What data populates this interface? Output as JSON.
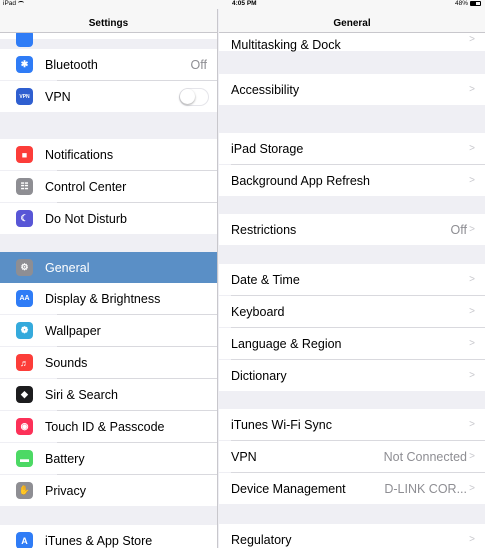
{
  "status_bar": {
    "device": "iPad",
    "time": "4:05 PM",
    "battery": "48%"
  },
  "master": {
    "title": "Settings",
    "items": [
      {
        "label": "",
        "icon": "partial-icon",
        "color": "#2f7cf6"
      },
      {
        "label": "Bluetooth",
        "value": "Off",
        "icon": "bluetooth-icon",
        "color": "#2f7cf6"
      },
      {
        "label": "VPN",
        "icon": "vpn-icon",
        "color": "#2f5fd0",
        "toggle": false
      },
      {
        "label": "Notifications",
        "icon": "notifications-icon",
        "color": "#fc3d39"
      },
      {
        "label": "Control Center",
        "icon": "control-center-icon",
        "color": "#8e8e93"
      },
      {
        "label": "Do Not Disturb",
        "icon": "moon-icon",
        "color": "#5856d6"
      },
      {
        "label": "General",
        "icon": "gear-icon",
        "color": "#8e8e93",
        "selected": true
      },
      {
        "label": "Display & Brightness",
        "icon": "display-icon",
        "color": "#2f7cf6"
      },
      {
        "label": "Wallpaper",
        "icon": "wallpaper-icon",
        "color": "#35aadc"
      },
      {
        "label": "Sounds",
        "icon": "speaker-icon",
        "color": "#fc3d39"
      },
      {
        "label": "Siri & Search",
        "icon": "siri-icon",
        "color": "#1c1c1e"
      },
      {
        "label": "Touch ID & Passcode",
        "icon": "fingerprint-icon",
        "color": "#fc3158"
      },
      {
        "label": "Battery",
        "icon": "battery-icon",
        "color": "#4cd964"
      },
      {
        "label": "Privacy",
        "icon": "hand-icon",
        "color": "#8e8e93"
      },
      {
        "label": "iTunes & App Store",
        "icon": "app-store-icon",
        "color": "#2f7cf6"
      }
    ]
  },
  "detail": {
    "title": "General",
    "items": [
      {
        "label": "Multitasking & Dock"
      },
      {
        "label": "Accessibility"
      },
      {
        "label": "iPad Storage"
      },
      {
        "label": "Background App Refresh"
      },
      {
        "label": "Restrictions",
        "value": "Off"
      },
      {
        "label": "Date & Time"
      },
      {
        "label": "Keyboard"
      },
      {
        "label": "Language & Region"
      },
      {
        "label": "Dictionary"
      },
      {
        "label": "iTunes Wi-Fi Sync"
      },
      {
        "label": "VPN",
        "value": "Not Connected"
      },
      {
        "label": "Device Management",
        "value": "D-LINK COR..."
      },
      {
        "label": "Regulatory"
      }
    ],
    "chevron": ">"
  }
}
